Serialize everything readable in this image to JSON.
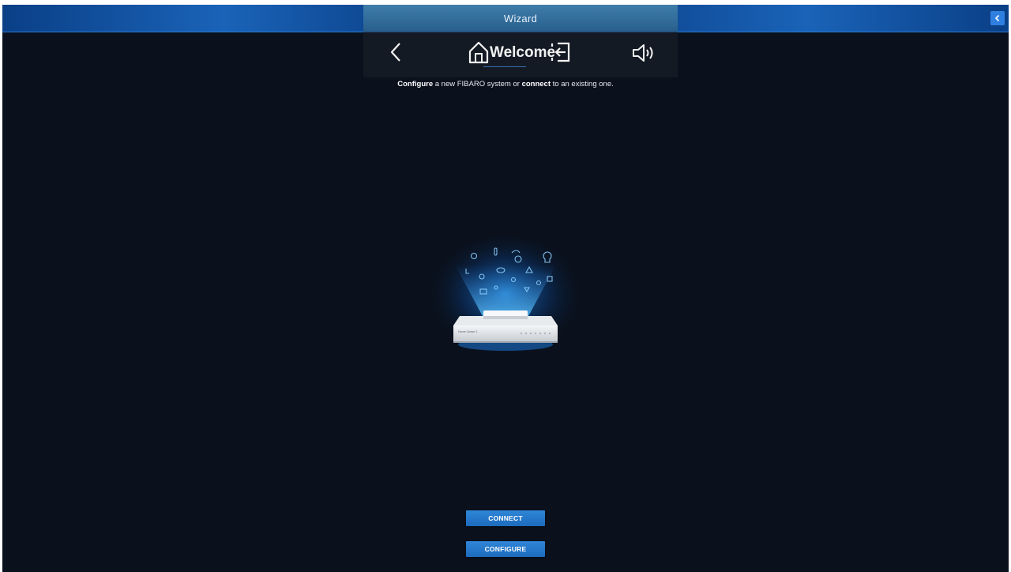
{
  "window": {
    "title": "Wizard"
  },
  "header": {
    "title": "Welcome",
    "icons": [
      "chevron-left-icon",
      "home-icon",
      "logout-icon",
      "speaker-icon",
      "collapse-icon"
    ]
  },
  "main": {
    "subtitle": {
      "part1_bold": "Configure",
      "part2": " a new FIBARO system or ",
      "part3_bold": "connect",
      "part4": " to an existing one."
    },
    "device_caption": "Home Center 2"
  },
  "actions": {
    "connect_label": "CONNECT",
    "configure_label": "CONFIGURE"
  },
  "colors": {
    "background": "#0a111d",
    "topbar_accent": "#1a63b8",
    "button": "#2f86d8"
  }
}
